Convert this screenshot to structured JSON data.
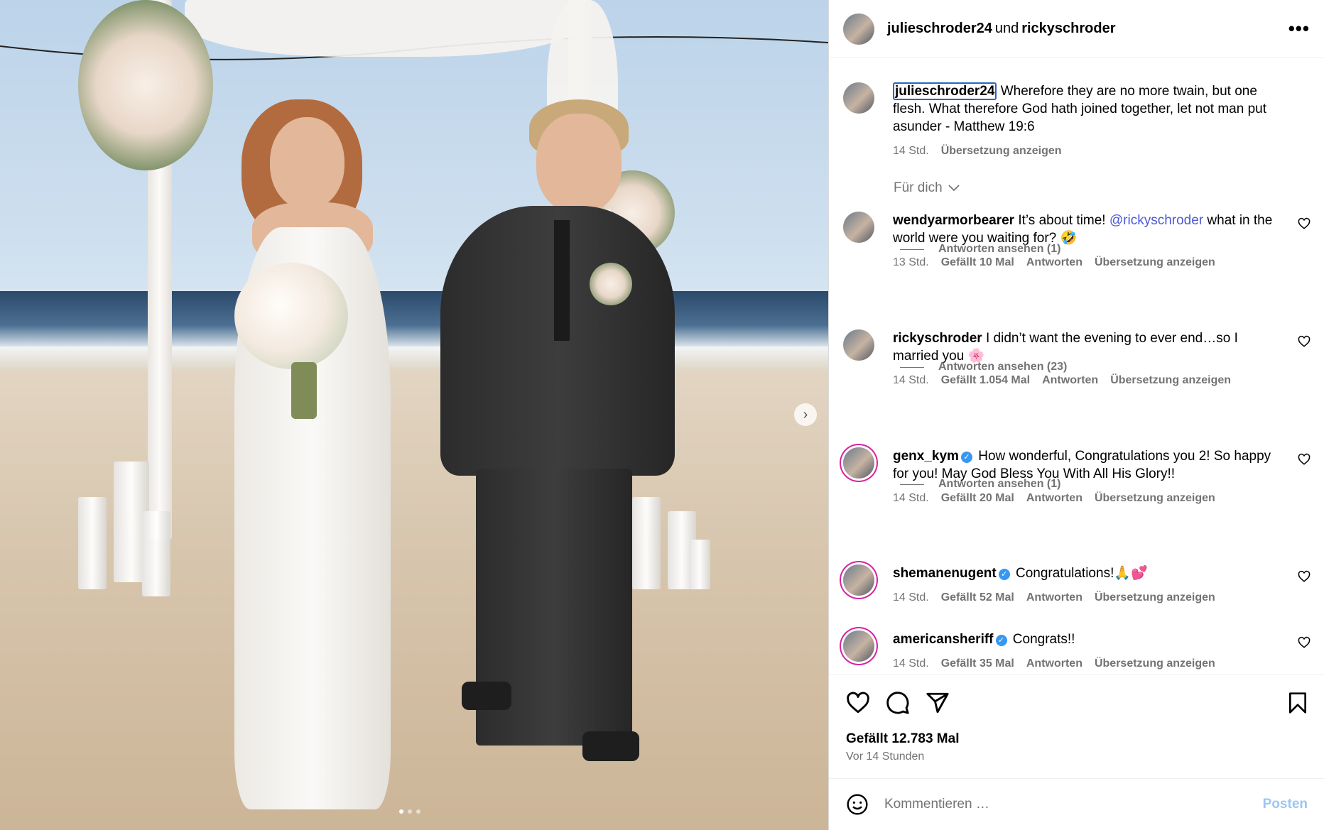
{
  "header": {
    "user1": "julieschroder24",
    "joiner": "und",
    "user2": "rickyschroder",
    "more_icon": "more-horizontal-icon"
  },
  "caption": {
    "username": "julieschroder24",
    "text": "Wherefore they are no more twain, but one flesh. What therefore God hath joined together, let not man put asunder - Matthew 19:6",
    "time": "14 Std.",
    "translate": "Übersetzung anzeigen"
  },
  "filter_label": "Für dich",
  "comments": [
    {
      "username": "wendyarmorbearer",
      "text_before": "It’s about time! ",
      "mention": "@rickyschroder",
      "text_after": " what in the world were you waiting for? 🤣",
      "time": "13 Std.",
      "likes": "Gefällt 10 Mal",
      "reply": "Antworten",
      "translate": "Übersetzung anzeigen",
      "view_replies": "Antworten ansehen (1)"
    },
    {
      "username": "rickyschroder",
      "text": "I didn’t want the evening to ever end…so I married you 🌸",
      "time": "14 Std.",
      "likes": "Gefällt 1.054 Mal",
      "reply": "Antworten",
      "translate": "Übersetzung anzeigen",
      "view_replies": "Antworten ansehen (23)"
    },
    {
      "username": "genx_kym",
      "text": "How wonderful, Congratulations you 2! So happy for you! May God Bless You With All His Glory!!",
      "time": "14 Std.",
      "likes": "Gefällt 20 Mal",
      "reply": "Antworten",
      "translate": "Übersetzung anzeigen",
      "view_replies": "Antworten ansehen (1)"
    },
    {
      "username": "shemanenugent",
      "text": "Congratulations!🙏💕",
      "time": "14 Std.",
      "likes": "Gefällt 52 Mal",
      "reply": "Antworten",
      "translate": "Übersetzung anzeigen"
    },
    {
      "username": "americansheriff",
      "text": "Congrats!!",
      "time": "14 Std.",
      "likes": "Gefällt 35 Mal",
      "reply": "Antworten",
      "translate": "Übersetzung anzeigen"
    }
  ],
  "actions": {
    "likes": "Gefällt 12.783 Mal",
    "time": "Vor 14 Stunden"
  },
  "composer": {
    "placeholder": "Kommentieren …",
    "post": "Posten"
  },
  "colors": {
    "mention": "#4c58d6",
    "verified": "#3897f0",
    "post_button_disabled": "#9cc6f6",
    "secondary_text": "#737373"
  },
  "carousel": {
    "slides": 3,
    "active": 1
  }
}
